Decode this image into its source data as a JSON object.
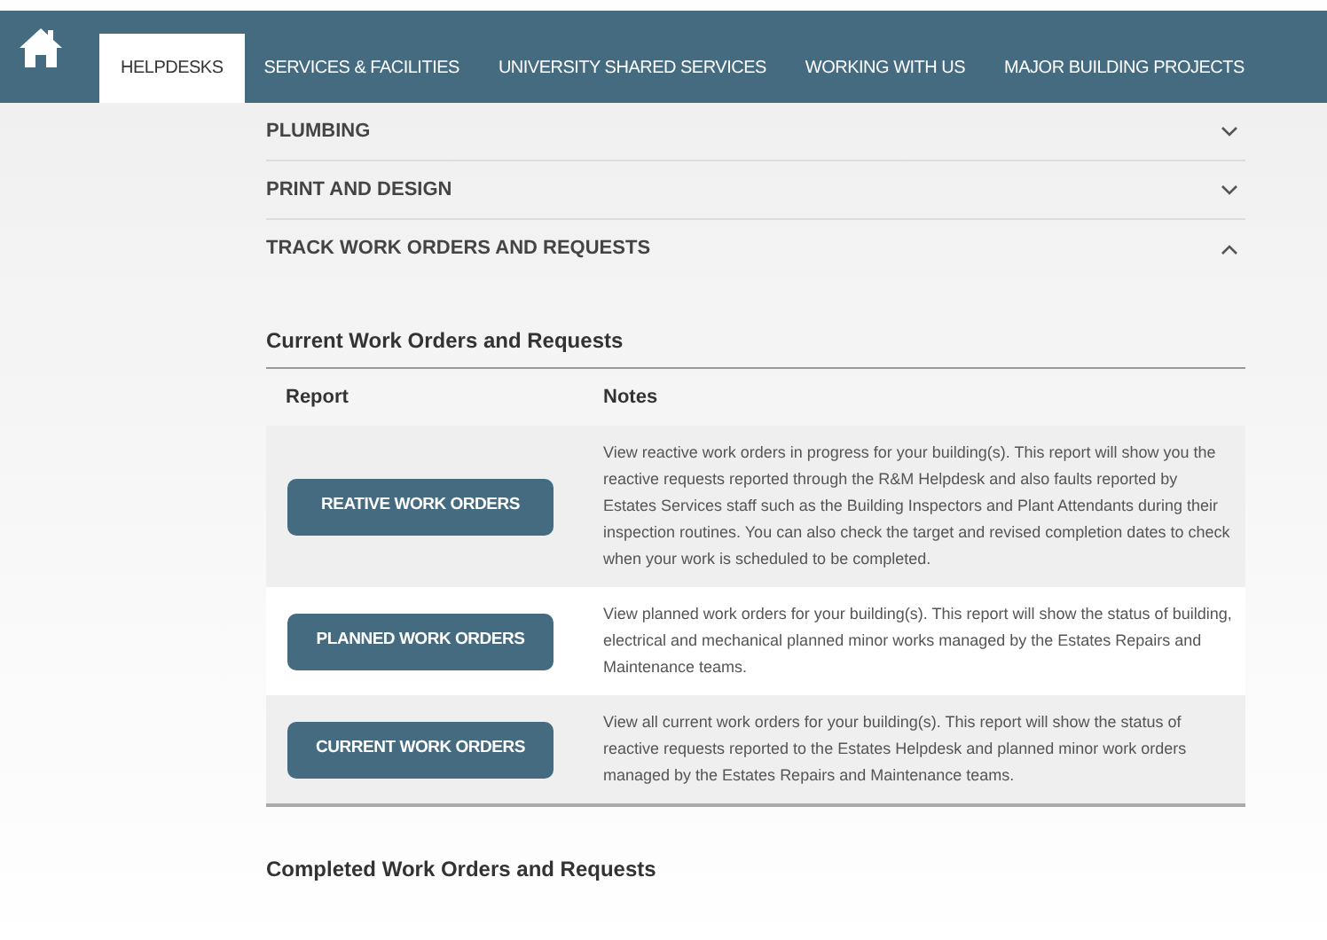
{
  "nav": {
    "tabs": [
      {
        "label": "HELPDESKS",
        "selected": true
      },
      {
        "label": "SERVICES & FACILITIES",
        "selected": false
      },
      {
        "label": "UNIVERSITY SHARED SERVICES",
        "selected": false
      },
      {
        "label": "WORKING WITH US",
        "selected": false
      },
      {
        "label": "MAJOR BUILDING PROJECTS",
        "selected": false
      }
    ]
  },
  "accordion": [
    {
      "title": "PLUMBING",
      "expanded": false
    },
    {
      "title": "PRINT AND DESIGN",
      "expanded": false
    },
    {
      "title": "TRACK WORK ORDERS AND REQUESTS",
      "expanded": true
    }
  ],
  "current_section": {
    "heading": "Current Work Orders and Requests",
    "columns": [
      "Report",
      "Notes"
    ],
    "rows": [
      {
        "button": "REATIVE WORK ORDERS",
        "notes": "View reactive work orders in progress for your building(s). This report will show you the reactive requests reported through the R&M Helpdesk and also faults reported by Estates Services staff such as the Building Inspectors and Plant Attendants during their inspection routines. You can also check the target and revised completion dates to check when your work is scheduled to be completed."
      },
      {
        "button": "PLANNED WORK ORDERS",
        "notes": "View planned work orders for your building(s).  This report will show the status of building, electrical and mechanical planned minor works managed by the Estates Repairs and Maintenance teams."
      },
      {
        "button": "CURRENT WORK ORDERS",
        "notes": "View all current work orders for your building(s).  This report will show the status of reactive requests reported to the Estates Helpdesk and planned minor work orders managed by the Estates Repairs and Maintenance teams."
      }
    ]
  },
  "completed_section": {
    "heading": "Completed Work Orders and Requests"
  }
}
